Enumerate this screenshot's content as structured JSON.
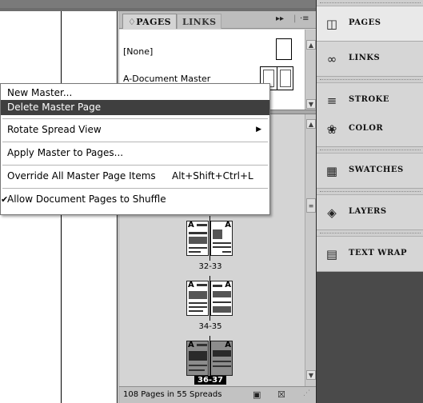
{
  "pages_panel": {
    "tabs": [
      {
        "label": "♢PAGES"
      },
      {
        "label": "LINKS"
      }
    ],
    "controls": {
      "collapse": "▸▸",
      "divider": "|",
      "menu": "·≡"
    },
    "masters": {
      "none_label": "[None]",
      "a_label": "A-Document Master"
    },
    "spreads": [
      {
        "label": "32-33"
      },
      {
        "label": "34-35"
      },
      {
        "label": "36-37"
      }
    ],
    "status": {
      "text": "108 Pages in 55 Spreads",
      "new_page_icon": "▣",
      "trash_icon": "☒"
    }
  },
  "context_menu": {
    "items": [
      {
        "label": "New Master..."
      },
      {
        "label": "Delete Master Page"
      },
      {
        "label": "Rotate Spread View",
        "arrow": "▶"
      },
      {
        "label": "Apply Master to Pages..."
      },
      {
        "label": "Override All Master Page Items",
        "shortcut": "Alt+Shift+Ctrl+L"
      },
      {
        "label": "Allow Document Pages to Shuffle",
        "check": "✔"
      }
    ]
  },
  "dock": {
    "items": [
      {
        "label": "PAGES",
        "icon": "◫",
        "icon_name": "pages-icon"
      },
      {
        "label": "LINKS",
        "icon": "∞",
        "icon_name": "links-icon"
      },
      {
        "label": "STROKE",
        "icon": "≡",
        "icon_name": "stroke-icon"
      },
      {
        "label": "COLOR",
        "icon": "❀",
        "icon_name": "color-icon"
      },
      {
        "label": "SWATCHES",
        "icon": "▦",
        "icon_name": "swatches-icon"
      },
      {
        "label": "LAYERS",
        "icon": "◈",
        "icon_name": "layers-icon"
      },
      {
        "label": "TEXT WRAP",
        "icon": "▤",
        "icon_name": "text-wrap-icon"
      }
    ]
  },
  "colors": {
    "highlight": "#3f3f3f",
    "dock_bg": "#4a4a4a",
    "panel_bg": "#d4d4d4"
  }
}
